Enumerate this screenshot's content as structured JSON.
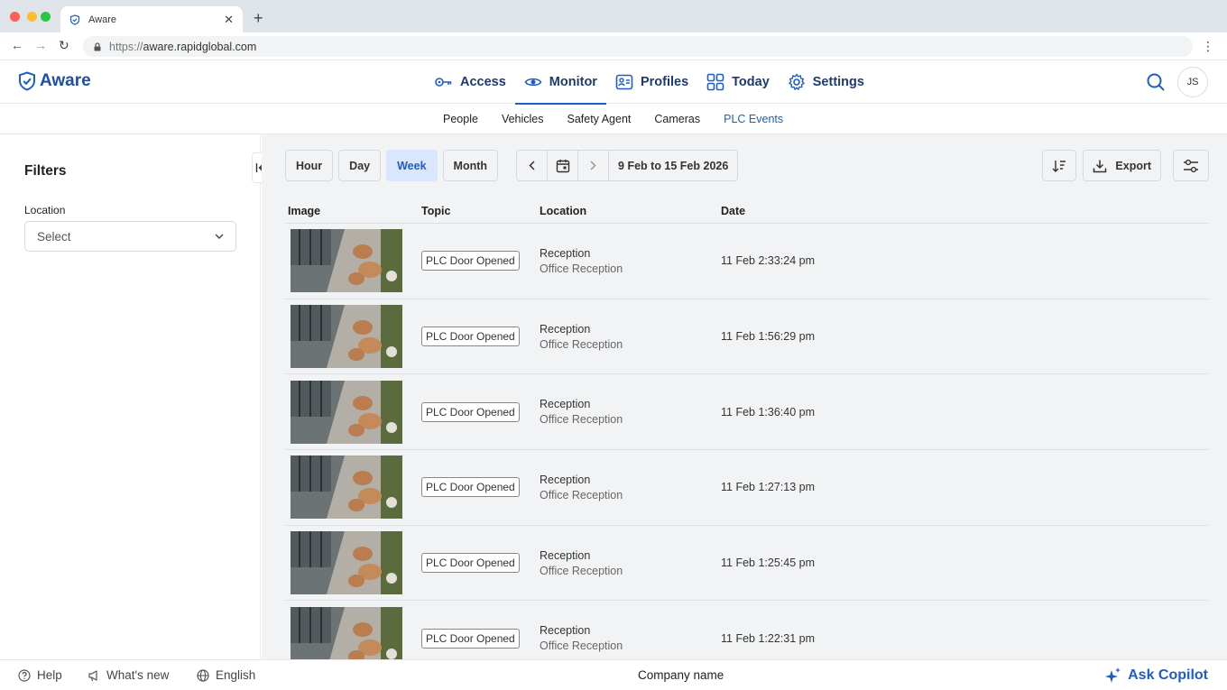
{
  "browser": {
    "tab_title": "Aware",
    "url_protocol": "https://",
    "url_host": "aware.rapidglobal.com"
  },
  "app": {
    "logo_text": "Aware",
    "avatar_initials": "JS",
    "brand_color": "#1e4fa8",
    "accent_color": "#1e5cc8"
  },
  "main_nav": [
    {
      "label": "Access",
      "icon": "key-icon"
    },
    {
      "label": "Monitor",
      "icon": "eye-icon",
      "active": true
    },
    {
      "label": "Profiles",
      "icon": "id-card-icon"
    },
    {
      "label": "Today",
      "icon": "grid-icon"
    },
    {
      "label": "Settings",
      "icon": "gear-icon"
    }
  ],
  "sub_nav": [
    {
      "label": "People"
    },
    {
      "label": "Vehicles"
    },
    {
      "label": "Safety Agent"
    },
    {
      "label": "Cameras"
    },
    {
      "label": "PLC Events",
      "active": true
    }
  ],
  "filters": {
    "title": "Filters",
    "location_label": "Location",
    "location_placeholder": "Select"
  },
  "toolbar": {
    "periods": [
      "Hour",
      "Day",
      "Week",
      "Month"
    ],
    "active_period": "Week",
    "date_range": "9 Feb to 15 Feb 2026",
    "export_label": "Export"
  },
  "table": {
    "headers": [
      "Image",
      "Topic",
      "Location",
      "Date"
    ],
    "rows": [
      {
        "topic": "PLC Door Opened",
        "location": "Reception",
        "sublocation": "Office Reception",
        "date": "11 Feb 2:33:24 pm"
      },
      {
        "topic": "PLC Door Opened",
        "location": "Reception",
        "sublocation": "Office Reception",
        "date": "11 Feb 1:56:29 pm"
      },
      {
        "topic": "PLC Door Opened",
        "location": "Reception",
        "sublocation": "Office Reception",
        "date": "11 Feb 1:36:40 pm"
      },
      {
        "topic": "PLC Door Opened",
        "location": "Reception",
        "sublocation": "Office Reception",
        "date": "11 Feb 1:27:13 pm"
      },
      {
        "topic": "PLC Door Opened",
        "location": "Reception",
        "sublocation": "Office Reception",
        "date": "11 Feb 1:25:45 pm"
      },
      {
        "topic": "PLC Door Opened",
        "location": "Reception",
        "sublocation": "Office Reception",
        "date": "11 Feb 1:22:31 pm"
      }
    ]
  },
  "footer": {
    "help": "Help",
    "whats_new": "What's new",
    "language": "English",
    "company": "Company name",
    "copilot": "Ask Copilot"
  }
}
